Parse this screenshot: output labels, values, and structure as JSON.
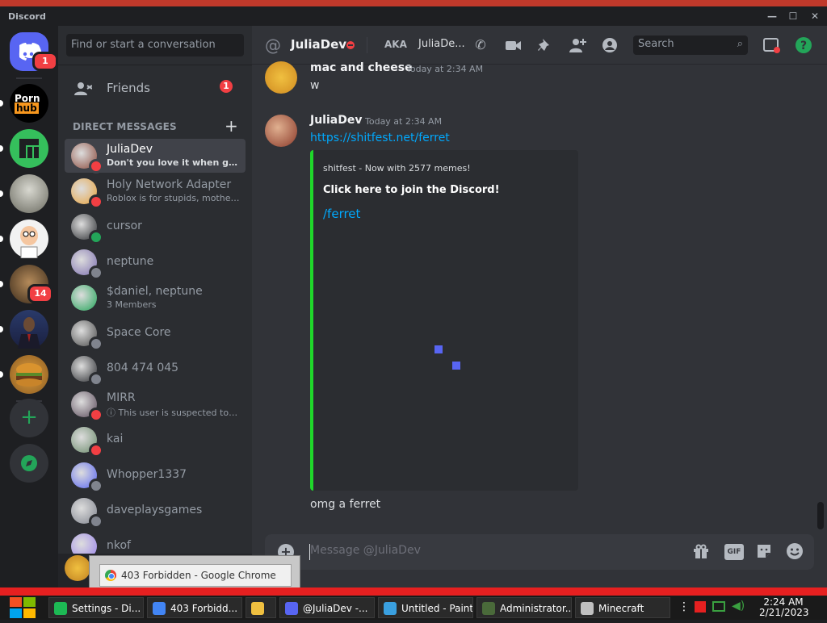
{
  "window": {
    "title": "Discord",
    "minimize": "—",
    "maximize": "☐",
    "close": "✕"
  },
  "servers": {
    "home_badge": "1",
    "server5_badge": "14",
    "add_label": "+",
    "explore_label": "⊕"
  },
  "dm_panel": {
    "search_placeholder": "Find or start a conversation",
    "friends_label": "Friends",
    "friends_badge": "1",
    "header": "DIRECT MESSAGES",
    "add_dm": "+",
    "items": [
      {
        "name": "JuliaDev",
        "sub": "Don't you love it when govern...",
        "status": "dnd",
        "avatar_color": "#8b4a3c"
      },
      {
        "name": "Holy Network Adapter",
        "sub": "Roblox is for stupids, motherf...",
        "status": "dnd",
        "avatar_color": "#e8a33d"
      },
      {
        "name": "cursor",
        "sub": "",
        "status": "online",
        "avatar_color": "#2b2d31"
      },
      {
        "name": "neptune",
        "sub": "",
        "status": "offline",
        "avatar_color": "#7d6fb0"
      },
      {
        "name": "$daniel, neptune",
        "sub": "3 Members",
        "status": "",
        "avatar_color": "#23a559"
      },
      {
        "name": "Space Core",
        "sub": "",
        "status": "offline",
        "avatar_color": "#4a4a4a"
      },
      {
        "name": "804 474 045",
        "sub": "",
        "status": "offline",
        "avatar_color": "#2b2d31"
      },
      {
        "name": "MIRR",
        "sub": "ⓘ This user is suspected to h...",
        "status": "dnd",
        "avatar_color": "#5a4a5a"
      },
      {
        "name": "kai",
        "sub": "",
        "status": "dnd",
        "avatar_color": "#6a8a6a"
      },
      {
        "name": "Whopper1337",
        "sub": "",
        "status": "offline",
        "avatar_color": "#5865f2"
      },
      {
        "name": "daveplaysgames",
        "sub": "",
        "status": "offline",
        "avatar_color": "#80848e"
      },
      {
        "name": "nkof",
        "sub": "",
        "status": "",
        "avatar_color": "#9b84ec"
      }
    ]
  },
  "chat": {
    "header_name": "JuliaDev",
    "aka_label": "AKA",
    "aka_value": "JuliaDe...",
    "search_placeholder": "Search",
    "messages": [
      {
        "author": "mac and cheese",
        "time": "Today at 2:34 AM",
        "text": "w"
      },
      {
        "author": "JuliaDev",
        "time": "Today at 2:34 AM",
        "link": "https://shitfest.net/ferret"
      }
    ],
    "embed": {
      "provider": "shitfest - Now with 2577 memes!",
      "title": "Click here to join the Discord!",
      "description": "/ferret",
      "border_color": "#1fd72a"
    },
    "followup_text": "omg a ferret",
    "composer_placeholder": "Message @JuliaDev",
    "gif_label": "GIF"
  },
  "tooltip": {
    "text": "403 Forbidden - Google Chrome"
  },
  "taskbar": {
    "items": [
      {
        "label": "Settings - Di...",
        "color": "#1db954"
      },
      {
        "label": "403 Forbidd...",
        "color": "#4285f4"
      },
      {
        "label": "",
        "color": "#f0c040"
      },
      {
        "label": "@JuliaDev -...",
        "color": "#5865f2"
      },
      {
        "label": "Untitled - Paint",
        "color": "#3aa0e0"
      },
      {
        "label": "Administrator...",
        "color": "#4a6a3a"
      },
      {
        "label": "Minecraft",
        "color": "#c0c0c0"
      }
    ],
    "time": "2:24 AM",
    "date": "2/21/2023"
  }
}
